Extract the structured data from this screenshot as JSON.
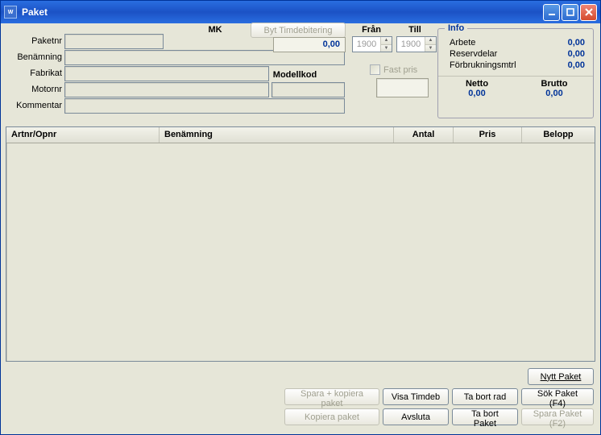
{
  "window": {
    "title": "Paket"
  },
  "form": {
    "labels": {
      "paketnr": "Paketnr",
      "benamning": "Benämning",
      "fabrikat": "Fabrikat",
      "motornr": "Motornr",
      "kommentar": "Kommentar",
      "mk": "MK",
      "modellkod": "Modellkod",
      "fran": "Från",
      "till": "Till",
      "fast_pris": "Fast pris"
    },
    "values": {
      "paketnr": "",
      "benamning": "",
      "fabrikat": "",
      "motornr": "",
      "kommentar": "",
      "modellkod": "",
      "mk": "0,00",
      "fran": "1900",
      "till": "1900"
    },
    "byt_timdebitering": "Byt Timdebitering"
  },
  "info": {
    "legend": "Info",
    "rows": {
      "arbete": {
        "label": "Arbete",
        "value": "0,00"
      },
      "reservdelar": {
        "label": "Reservdelar",
        "value": "0,00"
      },
      "forbrukning": {
        "label": "Förbrukningsmtrl",
        "value": "0,00"
      }
    },
    "netto": {
      "label": "Netto",
      "value": "0,00"
    },
    "brutto": {
      "label": "Brutto",
      "value": "0,00"
    }
  },
  "grid": {
    "columns": {
      "artnr": "Artnr/Opnr",
      "benamning": "Benämning",
      "antal": "Antal",
      "pris": "Pris",
      "belopp": "Belopp"
    }
  },
  "buttons": {
    "nytt_paket": "Nytt Paket",
    "spara_kopiera": "Spara + kopiera paket",
    "visa_timdeb": "Visa Timdeb",
    "ta_bort_rad": "Ta bort rad",
    "sok_paket": "Sök Paket (F4)",
    "kopiera_paket": "Kopiera paket",
    "avsluta": "Avsluta",
    "ta_bort_paket": "Ta bort Paket",
    "spara_paket": "Spara Paket (F2)"
  }
}
